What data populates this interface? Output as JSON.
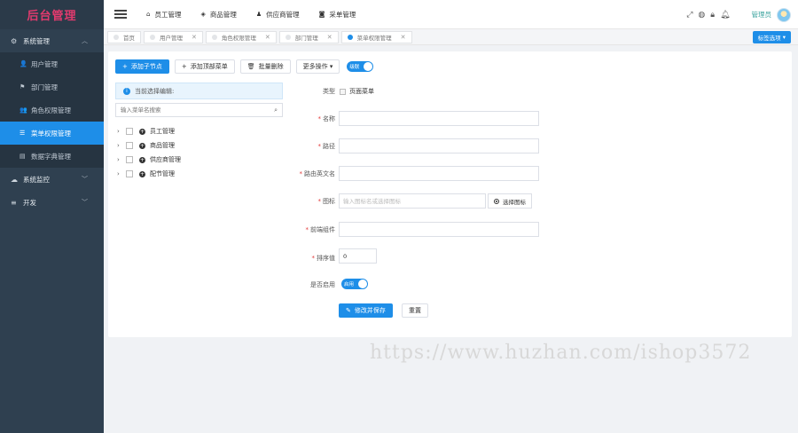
{
  "app": {
    "logo": "后台管理"
  },
  "sidebar": {
    "groups": [
      {
        "label": "系统管理",
        "icon": "gear-icon",
        "expanded": true,
        "items": [
          {
            "label": "用户管理",
            "icon": "user-icon"
          },
          {
            "label": "部门管理",
            "icon": "flag-icon"
          },
          {
            "label": "角色权限管理",
            "icon": "users-icon"
          },
          {
            "label": "菜单权限管理",
            "icon": "list-icon",
            "active": true
          },
          {
            "label": "数据字典管理",
            "icon": "book-icon"
          }
        ]
      },
      {
        "label": "系统监控",
        "icon": "cloud-icon"
      },
      {
        "label": "开发",
        "icon": "dev-icon"
      }
    ]
  },
  "topbar": {
    "nav": [
      {
        "label": "员工管理",
        "icon": "home-icon"
      },
      {
        "label": "商品管理",
        "icon": "tag-icon"
      },
      {
        "label": "供应商管理",
        "icon": "person-icon"
      },
      {
        "label": "采单管理",
        "icon": "camera-icon"
      }
    ],
    "admin": "管理员"
  },
  "tabs": {
    "items": [
      {
        "label": "首页",
        "closable": false,
        "active": false
      },
      {
        "label": "用户管理",
        "closable": true,
        "active": false
      },
      {
        "label": "角色权限管理",
        "closable": true,
        "active": false
      },
      {
        "label": "部门管理",
        "closable": true,
        "active": false
      },
      {
        "label": "菜单权限管理",
        "closable": true,
        "active": true
      }
    ],
    "options_label": "标签选项"
  },
  "toolbar": {
    "add_child": "添加子节点",
    "add_top": "添加顶部菜单",
    "batch_delete": "批量删除",
    "more": "更多操作",
    "toggle_label": "级联"
  },
  "tree": {
    "selected_label": "当前选择编辑:",
    "search_placeholder": "输入菜单名搜索",
    "nodes": [
      "员工管理",
      "商品管理",
      "供应商管理",
      "配节管理"
    ]
  },
  "form": {
    "type_label": "类型",
    "type_value": "页面菜单",
    "name_label": "名称",
    "path_label": "路径",
    "route_label": "路由英文名",
    "icon_label": "图标",
    "icon_placeholder": "输入图标名或选择图标",
    "icon_button": "选择图标",
    "component_label": "前端组件",
    "sort_label": "排序值",
    "sort_value": "0",
    "enabled_label": "是否启用",
    "enabled_toggle": "启用",
    "save_button": "修改并保存",
    "reset_button": "重置"
  },
  "watermark": "https://www.huzhan.com/ishop3572"
}
